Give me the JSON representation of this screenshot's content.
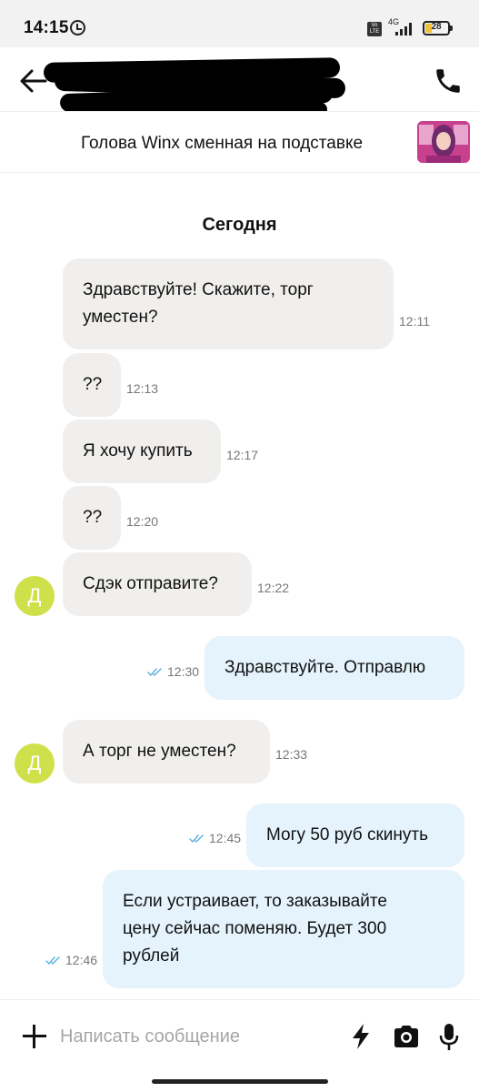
{
  "status_bar": {
    "time": "14:15",
    "network_type": "4G",
    "volte": "Vo LTE",
    "battery_level": "28"
  },
  "header": {
    "contact_name_redacted": true
  },
  "product": {
    "title": "Голова Winx сменная на подставке"
  },
  "chat": {
    "day_label": "Сегодня",
    "avatar_letter": "Д",
    "messages": [
      {
        "direction": "in",
        "text_lines": [
          "Здравствуйте! Скажите, торг",
          "уместен?"
        ],
        "time": "12:11"
      },
      {
        "direction": "in",
        "text_lines": [
          "??"
        ],
        "time": "12:13"
      },
      {
        "direction": "in",
        "text_lines": [
          "Я хочу купить"
        ],
        "time": "12:17"
      },
      {
        "direction": "in",
        "text_lines": [
          "??"
        ],
        "time": "12:20"
      },
      {
        "direction": "in",
        "text_lines": [
          "Сдэк отправите?"
        ],
        "time": "12:22"
      },
      {
        "direction": "out",
        "text_lines": [
          "Здравствуйте. Отправлю"
        ],
        "time": "12:30",
        "read": true
      },
      {
        "direction": "in",
        "text_lines": [
          "А торг не уместен?"
        ],
        "time": "12:33"
      },
      {
        "direction": "out",
        "text_lines": [
          "Могу 50 руб скинуть"
        ],
        "time": "12:45",
        "read": true
      },
      {
        "direction": "out",
        "text_lines": [
          "Если устраивает, то заказывайте",
          "цену сейчас поменяю. Будет 300",
          "рублей"
        ],
        "time": "12:46",
        "read": true
      }
    ]
  },
  "composer": {
    "placeholder": "Написать сообщение"
  },
  "colors": {
    "incoming_bubble": "#f0efed",
    "outgoing_bubble": "#e4f3fc",
    "avatar": "#cfe04a",
    "read_checks": "#5fb3e0"
  },
  "icons": [
    "back-arrow-icon",
    "phone-icon",
    "plus-icon",
    "lightning-icon",
    "camera-icon",
    "microphone-icon",
    "double-check-icon",
    "alarm-icon",
    "signal-icon",
    "battery-icon"
  ]
}
